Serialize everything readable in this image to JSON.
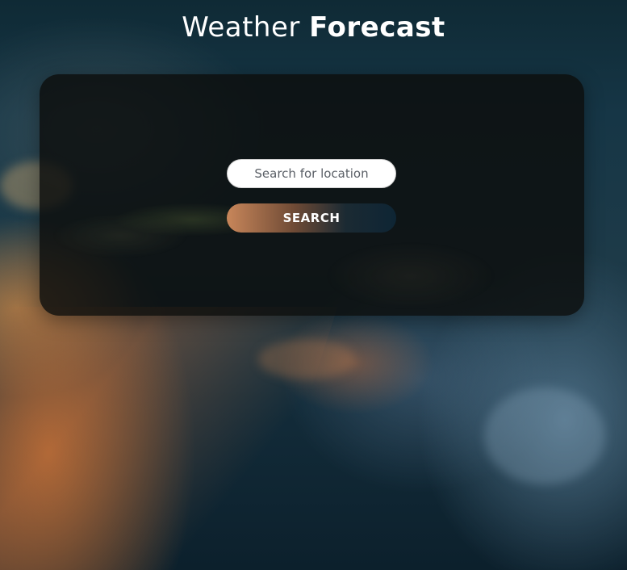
{
  "header": {
    "title_light": "Weather ",
    "title_bold": "Forecast"
  },
  "search": {
    "placeholder": "Search for location",
    "value": "",
    "button_label": "SEARCH"
  },
  "colors": {
    "panel_background": "#0c0e0c",
    "button_gradient_start": "#c8865a",
    "button_gradient_end": "#0e2534",
    "text_primary": "#ffffff"
  }
}
